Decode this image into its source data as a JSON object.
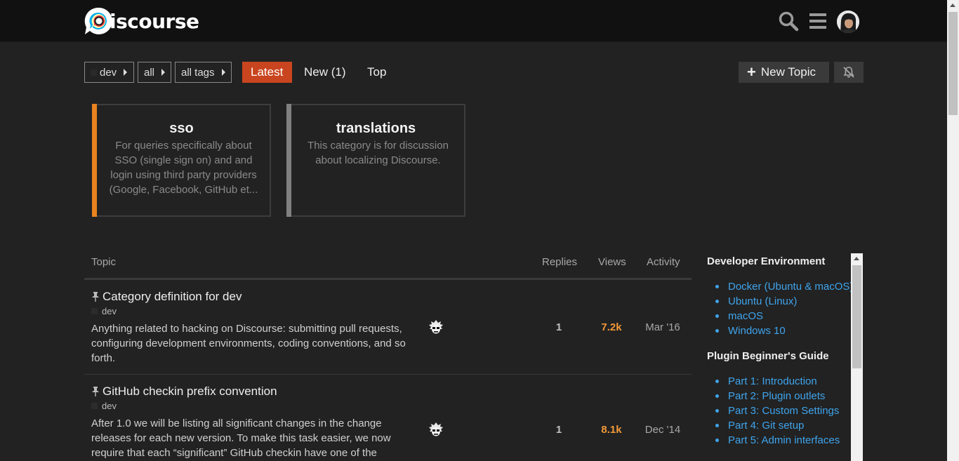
{
  "header": {
    "logo_text": "iscourse",
    "icons": [
      "search-icon",
      "hamburger-menu-icon",
      "user-avatar"
    ]
  },
  "nav": {
    "category_dropdown": "dev",
    "subcategory_dropdown": "all",
    "tags_dropdown": "all tags",
    "tabs": [
      {
        "label": "Latest",
        "active": true
      },
      {
        "label": "New (1)",
        "active": false
      },
      {
        "label": "Top",
        "active": false
      }
    ],
    "new_topic_label": "New Topic",
    "notification_icon": "bell-slash-icon"
  },
  "subcategories": [
    {
      "name": "sso",
      "description": "For queries specifically about SSO (single sign on) and and login using third party providers (Google, Facebook, GitHub et...",
      "color": "#e9831f"
    },
    {
      "name": "translations",
      "description": "This category is for discussion about localizing Discourse.",
      "color": "#808080"
    }
  ],
  "topic_list": {
    "headers": {
      "topic": "Topic",
      "replies": "Replies",
      "views": "Views",
      "activity": "Activity"
    },
    "topics": [
      {
        "title": "Category definition for dev",
        "category": "dev",
        "excerpt": "Anything related to hacking on Discourse: submitting pull requests, configuring development environments, coding conventions, and so forth.",
        "replies": "1",
        "views": "7.2k",
        "activity": "Mar '16"
      },
      {
        "title": "GitHub checkin prefix convention",
        "category": "dev",
        "excerpt": "After 1.0 we will be listing all significant changes in the change releases for each new version. To make this task easier, we now require that each “significant” GitHub checkin have one of the",
        "replies": "1",
        "views": "8.1k",
        "activity": "Dec '14"
      }
    ]
  },
  "sidebar": {
    "sections": [
      {
        "heading": "Developer Environment",
        "links": [
          "Docker (Ubuntu & macOS)",
          "Ubuntu (Linux)",
          "macOS",
          "Windows 10"
        ]
      },
      {
        "heading": "Plugin Beginner's Guide",
        "links": [
          "Part 1: Introduction",
          "Part 2: Plugin outlets",
          "Part 3: Custom Settings",
          "Part 4: Git setup",
          "Part 5: Admin interfaces"
        ]
      }
    ]
  },
  "colors": {
    "accent": "#c9451f",
    "views_orange": "#f29838",
    "link_blue": "#3fa4ec",
    "header_bg": "#111111",
    "page_bg": "#222222"
  }
}
